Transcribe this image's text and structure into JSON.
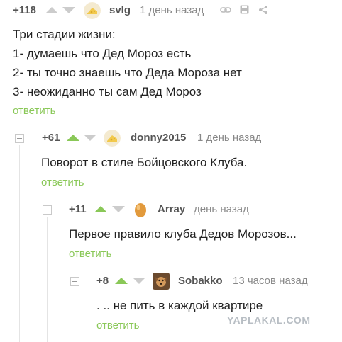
{
  "comments": [
    {
      "rating": "+118",
      "author": "svlg",
      "time": "1 день назад",
      "lines": [
        "Три стадии жизни:",
        "1- думаешь что Дед Мороз есть",
        "2- ты точно знаешь что Деда Мороза нет",
        "3- неожиданно ты сам Дед Мороз"
      ],
      "reply": "ответить",
      "upvoted": false,
      "avatar_icon": "cheese-avatar-icon"
    },
    {
      "rating": "+61",
      "author": "donny2015",
      "time": "1 день назад",
      "lines": [
        "Поворот в стиле Бойцовского Клуба."
      ],
      "reply": "ответить",
      "upvoted": true,
      "avatar_icon": "cheese-avatar-icon"
    },
    {
      "rating": "+11",
      "author": "Array",
      "time": "день назад",
      "lines": [
        "Первое правило клуба Дедов Морозов..."
      ],
      "reply": "ответить",
      "upvoted": true,
      "avatar_icon": "egg-avatar-icon"
    },
    {
      "rating": "+8",
      "author": "Sobakko",
      "time": "13 часов назад",
      "lines": [
        ". .. не пить в каждой квартире"
      ],
      "reply": "ответить",
      "upvoted": true,
      "avatar_icon": "dog-photo-avatar-icon"
    }
  ],
  "watermark": "YAPLAKAL.COM",
  "colors": {
    "accent": "#8ac858",
    "muted": "#cccccc",
    "text": "#222222",
    "meta": "#888888"
  }
}
